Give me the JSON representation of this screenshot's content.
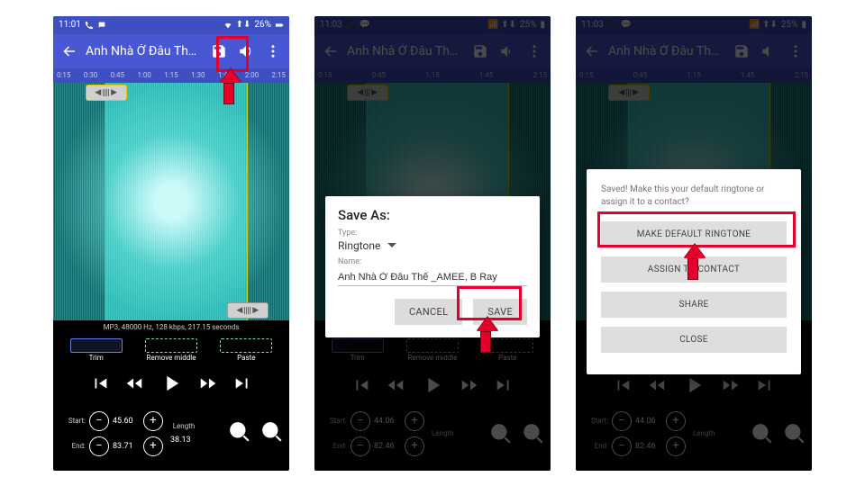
{
  "status": {
    "time1": "11:01",
    "time2": "11:03",
    "time3": "11:03",
    "batt1": "26%",
    "batt2": "25%",
    "batt3": "25%"
  },
  "appbar": {
    "title": "Anh Nhà Ở Đâu Thế..."
  },
  "ruler": [
    "0:15",
    "0:30",
    "0:45",
    "1:00",
    "1:15",
    "1:30",
    "1:45",
    "2:00",
    "2:15"
  ],
  "info": "MP3, 48000 Hz, 128 kbps, 217.15 seconds",
  "tools": {
    "trim": "Trim",
    "remove": "Remove middle",
    "paste": "Paste"
  },
  "range": {
    "startLabel": "Start:",
    "endLabel": "End:",
    "lengthLabel": "Length",
    "start1": "45.60",
    "end1": "83.71",
    "start2": "44.06",
    "end2": "82.46",
    "start3": "44.06",
    "end3": "82.46",
    "length1": "38.13"
  },
  "saveas": {
    "title": "Save As:",
    "typeLabel": "Type:",
    "type": "Ringtone",
    "nameLabel": "Name:",
    "name": "Anh Nhà Ở Đâu Thế _AMEE, B Ray",
    "cancel": "CANCEL",
    "save": "SAVE"
  },
  "result": {
    "msg": "Saved! Make this your default ringtone or assign it to a contact?",
    "opt1": "MAKE DEFAULT RINGTONE",
    "opt2": "ASSIGN TO CONTACT",
    "opt3": "SHARE",
    "opt4": "CLOSE"
  }
}
